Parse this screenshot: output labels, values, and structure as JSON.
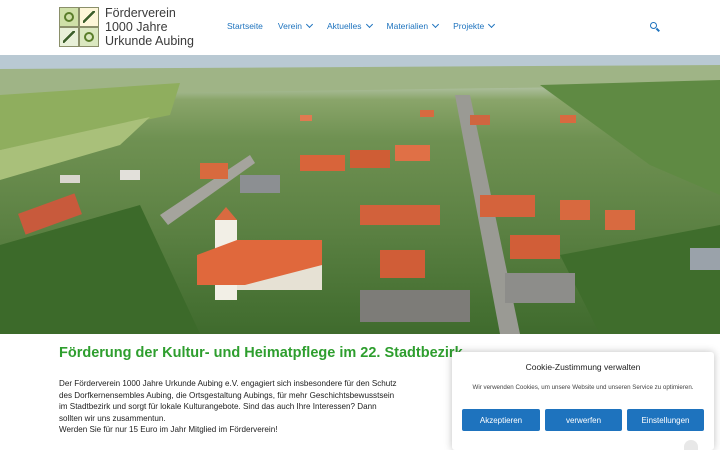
{
  "header": {
    "title_lines": [
      "Förderverein",
      "1000 Jahre",
      "Urkunde Aubing"
    ],
    "nav": [
      {
        "label": "Startseite",
        "has_dropdown": false
      },
      {
        "label": "Verein",
        "has_dropdown": true
      },
      {
        "label": "Aktuelles",
        "has_dropdown": true
      },
      {
        "label": "Materialien",
        "has_dropdown": true
      },
      {
        "label": "Projekte",
        "has_dropdown": true
      }
    ],
    "search_icon": "search-icon"
  },
  "hero": {
    "image": "aerial-village-photo"
  },
  "main": {
    "headline": "Förderung der Kultur- und Heimatpflege im 22. Stadtbezirk",
    "paragraph_lines": [
      "Der Förderverein 1000 Jahre Urkunde Aubing e.V.  engagiert sich insbesondere für den Schutz",
      "des Dorfkernensembles Aubing, die Ortsgestaltung Aubings, für mehr Geschichtsbewusstsein",
      "im Stadtbezirk und sorgt für lokale Kulturangebote. Sind das auch Ihre Interessen? Dann",
      "sollten wir uns zusammentun.",
      "Werden Sie für nur 15 Euro im Jahr Mitglied im Förderverein!"
    ]
  },
  "cookie": {
    "title": "Cookie-Zustimmung verwalten",
    "text": "Wir verwenden Cookies, um unsere Website und unseren Service zu optimieren.",
    "accept_label": "Akzeptieren",
    "reject_label": "verwerfen",
    "settings_label": "Einstellungen"
  },
  "colors": {
    "accent": "#1e73be",
    "headline": "#2e9e2e"
  }
}
